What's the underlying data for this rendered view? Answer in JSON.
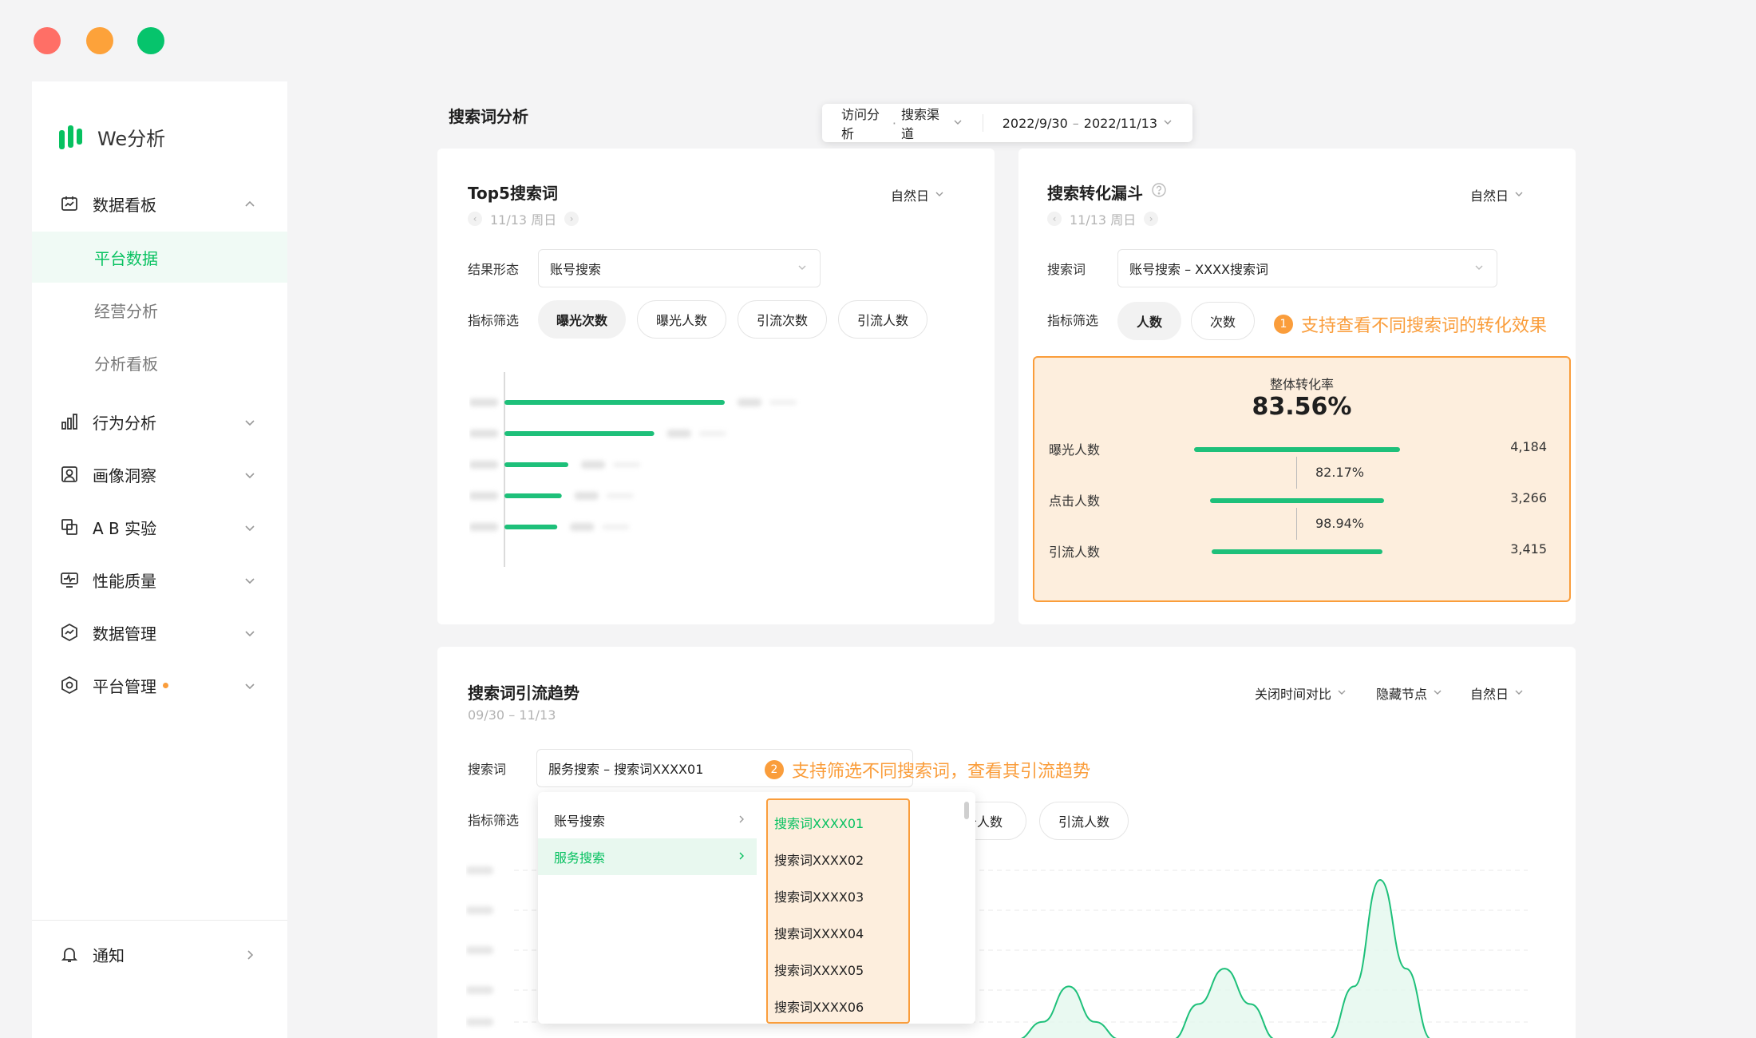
{
  "window": {
    "controls": [
      "close",
      "minimize",
      "maximize"
    ]
  },
  "sidebar": {
    "logo_text": "We分析",
    "items": [
      {
        "label": "数据看板",
        "icon": "calendar-chart-icon",
        "expanded": true
      },
      {
        "label": "平台数据",
        "sub": true,
        "active": true
      },
      {
        "label": "经营分析",
        "sub": true
      },
      {
        "label": "分析看板",
        "sub": true
      },
      {
        "label": "行为分析",
        "icon": "bar-chart-icon"
      },
      {
        "label": "画像洞察",
        "icon": "portrait-icon"
      },
      {
        "label": "A B 实验",
        "icon": "ab-test-icon"
      },
      {
        "label": "性能质量",
        "icon": "monitor-icon"
      },
      {
        "label": "数据管理",
        "icon": "data-hexagon-icon"
      },
      {
        "label": "平台管理",
        "icon": "settings-hexagon-icon",
        "badge": true
      }
    ],
    "notify_label": "通知"
  },
  "header": {
    "title": "搜索词分析",
    "filter_source": "访问分析",
    "filter_channel": "搜索渠道",
    "date_start": "2022/9/30",
    "date_end": "2022/11/13"
  },
  "top5": {
    "title": "Top5搜索词",
    "date": "11/13 周日",
    "period": "自然日",
    "result_label": "结果形态",
    "result_value": "账号搜索",
    "metric_label": "指标筛选",
    "metrics": [
      "曝光次数",
      "曝光人数",
      "引流次数",
      "引流人数"
    ]
  },
  "funnel": {
    "title": "搜索转化漏斗",
    "date": "11/13 周日",
    "period": "自然日",
    "term_label": "搜索词",
    "term_value": "账号搜索 – XXXX搜索词",
    "metric_label": "指标筛选",
    "metrics": [
      "人数",
      "次数"
    ],
    "annotation_num": "1",
    "annotation_text": "支持查看不同搜索词的转化效果",
    "overall_label": "整体转化率",
    "overall_value": "83.56%",
    "stages": [
      {
        "label": "曝光人数",
        "value": "4,184"
      },
      {
        "label": "点击人数",
        "value": "3,266"
      },
      {
        "label": "引流人数",
        "value": "3,415"
      }
    ],
    "rates": [
      "82.17%",
      "98.94%"
    ]
  },
  "trend": {
    "title": "搜索词引流趋势",
    "date_range": "09/30 – 11/13",
    "ctrl_compare": "关闭时间对比",
    "ctrl_hide": "隐藏节点",
    "period": "自然日",
    "term_label": "搜索词",
    "term_value": "服务搜索 – 搜索词XXXX01",
    "annotation_num": "2",
    "annotation_text": "支持筛选不同搜索词，查看其引流趋势",
    "metric_label": "指标筛选",
    "metrics_visible": [
      "击人数",
      "引流人数"
    ],
    "menu_categories": [
      "账号搜索",
      "服务搜索"
    ],
    "menu_terms": [
      "搜索词XXXX01",
      "搜索词XXXX02",
      "搜索词XXXX03",
      "搜索词XXXX04",
      "搜索词XXXX05",
      "搜索词XXXX06"
    ]
  },
  "colors": {
    "accent": "#07c160",
    "bar": "#1ec07a",
    "highlight": "#fa9d3b",
    "highlight_bg": "#fdeedd"
  },
  "chart_data": [
    {
      "type": "bar",
      "orientation": "horizontal",
      "categories": [
        "",
        "",
        "",
        "",
        ""
      ],
      "values": [
        100,
        68,
        29,
        26,
        24
      ],
      "note": "labels and values blurred in the original"
    },
    {
      "type": "area",
      "series": [
        {
          "values": [
            0,
            0,
            0,
            0,
            0,
            1,
            3,
            1,
            0,
            0,
            0,
            2,
            4,
            2,
            0,
            0,
            0,
            3,
            9,
            4,
            0,
            0,
            0,
            0,
            0
          ]
        }
      ],
      "note": "axis labels blurred in the original; partially hidden by dropdown"
    }
  ]
}
